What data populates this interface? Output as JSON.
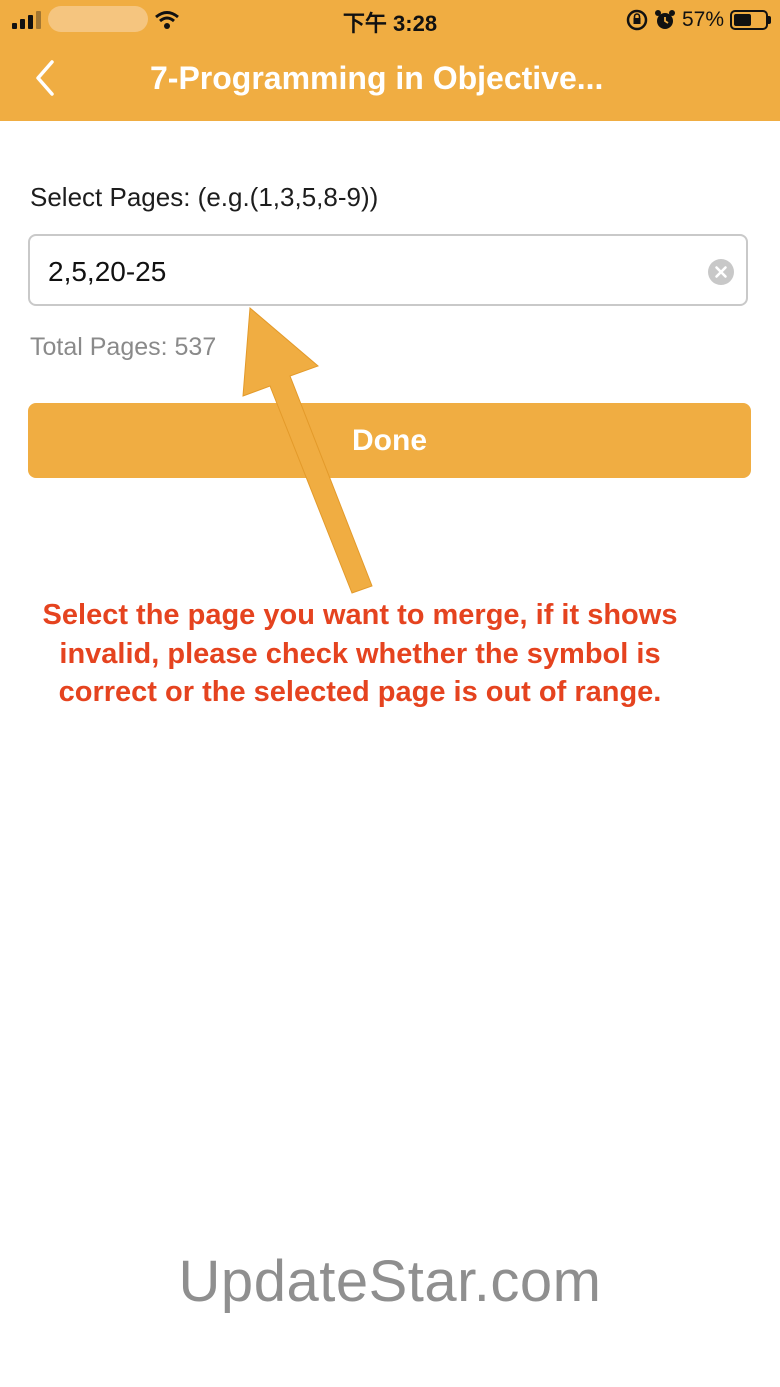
{
  "status_bar": {
    "time": "下午 3:28",
    "battery": "57%",
    "battery_level": 0.57
  },
  "nav": {
    "title": "7-Programming in Objective..."
  },
  "form": {
    "label": "Select Pages: (e.g.(1,3,5,8-9))",
    "pages_value": "2,5,20-25",
    "total_pages": "Total Pages: 537",
    "done_label": "Done"
  },
  "annotation": {
    "text": "Select the page you want to merge, if it shows invalid, please check whether the symbol is correct or the selected page is out of range."
  },
  "watermark": "UpdateStar.com",
  "colors": {
    "accent": "#f0ad42",
    "annotation": "#e5431f"
  }
}
